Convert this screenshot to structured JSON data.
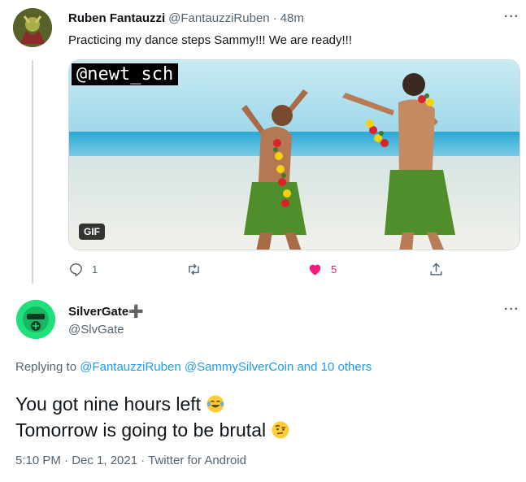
{
  "tweet1": {
    "name": "Ruben Fantauzzi",
    "handle": "@FantauzziRuben",
    "separator": "·",
    "time": "48m",
    "more": "···",
    "text": "Practicing my dance steps Sammy!!!  We are ready!!!",
    "media": {
      "watermark": "@newt_sch",
      "badge": "GIF"
    },
    "actions": {
      "reply_count": "1",
      "like_count": "5"
    },
    "colors": {
      "like": "#f91880",
      "muted": "#536471"
    }
  },
  "tweet2": {
    "name": "SilverGate➕",
    "handle": "@SlvGate",
    "more": "···",
    "replying_prefix": "Replying to",
    "replying_to": [
      "@FantauzziRuben",
      "@SammySilverCoin"
    ],
    "replying_others": "and 10 others",
    "lines": [
      "You got nine hours left",
      "Tomorrow is going to be brutal"
    ],
    "emojis": [
      "face-with-tears-of-joy",
      "face-with-raised-eyebrow"
    ],
    "timestamp": "5:10 PM · Dec 1, 2021 · Twitter for Android",
    "colors": {
      "link": "#1d9bf0",
      "avatar_bg": "#1fe07c"
    }
  }
}
